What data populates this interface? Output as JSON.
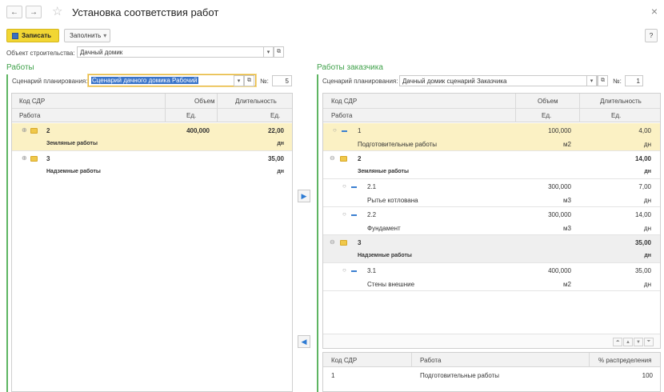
{
  "window": {
    "title": "Установка соответствия работ",
    "back_glyph": "←",
    "forward_glyph": "→",
    "favorite_glyph": "☆",
    "close_glyph": "×",
    "help_glyph": "?"
  },
  "toolbar": {
    "save_label": "Записать",
    "fill_label": "Заполнить",
    "fill_arrow": "▾"
  },
  "object": {
    "label": "Объект строительства:",
    "value": "Дачный домик"
  },
  "left": {
    "section_title": "Работы",
    "scenario_label": "Сценарий планирования:",
    "scenario_value": "Сценарий дачного домика Рабочий",
    "num_label": "№:",
    "num_value": "5",
    "headers": {
      "code": "Код СДР",
      "volume": "Объем",
      "duration": "Длительность",
      "work": "Работа",
      "unit": "Ед.",
      "unit2": "Ед."
    },
    "rows": [
      {
        "code": "2",
        "volume": "400,000",
        "duration": "22,00",
        "work": "Земляные работы",
        "unit": "",
        "unit2": "дн"
      },
      {
        "code": "3",
        "volume": "",
        "duration": "35,00",
        "work": "Надземные работы",
        "unit": "",
        "unit2": "дн"
      }
    ]
  },
  "right": {
    "section_title": "Работы заказчика",
    "scenario_label": "Сценарий планирования:",
    "scenario_value": "Дачный домик сценарий Заказчика",
    "num_label": "№:",
    "num_value": "1",
    "headers": {
      "code": "Код СДР",
      "volume": "Объем",
      "duration": "Длительность",
      "work": "Работа",
      "unit": "Ед.",
      "unit2": "Ед."
    },
    "rows": [
      {
        "code": "1",
        "volume": "100,000",
        "duration": "4,00",
        "work": "Подготовительные работы",
        "unit": "м2",
        "unit2": "дн"
      },
      {
        "code": "2",
        "volume": "",
        "duration": "14,00",
        "work": "Земляные работы",
        "unit": "",
        "unit2": "дн"
      },
      {
        "code": "2.1",
        "volume": "300,000",
        "duration": "7,00",
        "work": "Рытье котлована",
        "unit": "м3",
        "unit2": "дн"
      },
      {
        "code": "2.2",
        "volume": "300,000",
        "duration": "14,00",
        "work": "Фундамент",
        "unit": "м3",
        "unit2": "дн"
      },
      {
        "code": "3",
        "volume": "",
        "duration": "35,00",
        "work": "Надземные работы",
        "unit": "",
        "unit2": "дн"
      },
      {
        "code": "3.1",
        "volume": "400,000",
        "duration": "35,00",
        "work": "Стены внешние",
        "unit": "м2",
        "unit2": "дн"
      }
    ]
  },
  "distribution": {
    "headers": {
      "code": "Код СДР",
      "work": "Работа",
      "percent": "% распределения"
    },
    "rows": [
      {
        "code": "1",
        "work": "Подготовительные работы",
        "percent": "100"
      }
    ]
  },
  "arrows": {
    "right": "▶",
    "left": "◀"
  },
  "scroll_glyphs": {
    "top": "⏶",
    "up": "▲",
    "down": "▼",
    "bottom": "⏷"
  },
  "colors": {
    "accent": "#3fa14a",
    "selection": "#fbf1c4",
    "primary_button": "#f2d633"
  },
  "icons": {
    "folder": "folder-icon",
    "item": "item-dash-icon",
    "open_form": "open-form-icon"
  }
}
